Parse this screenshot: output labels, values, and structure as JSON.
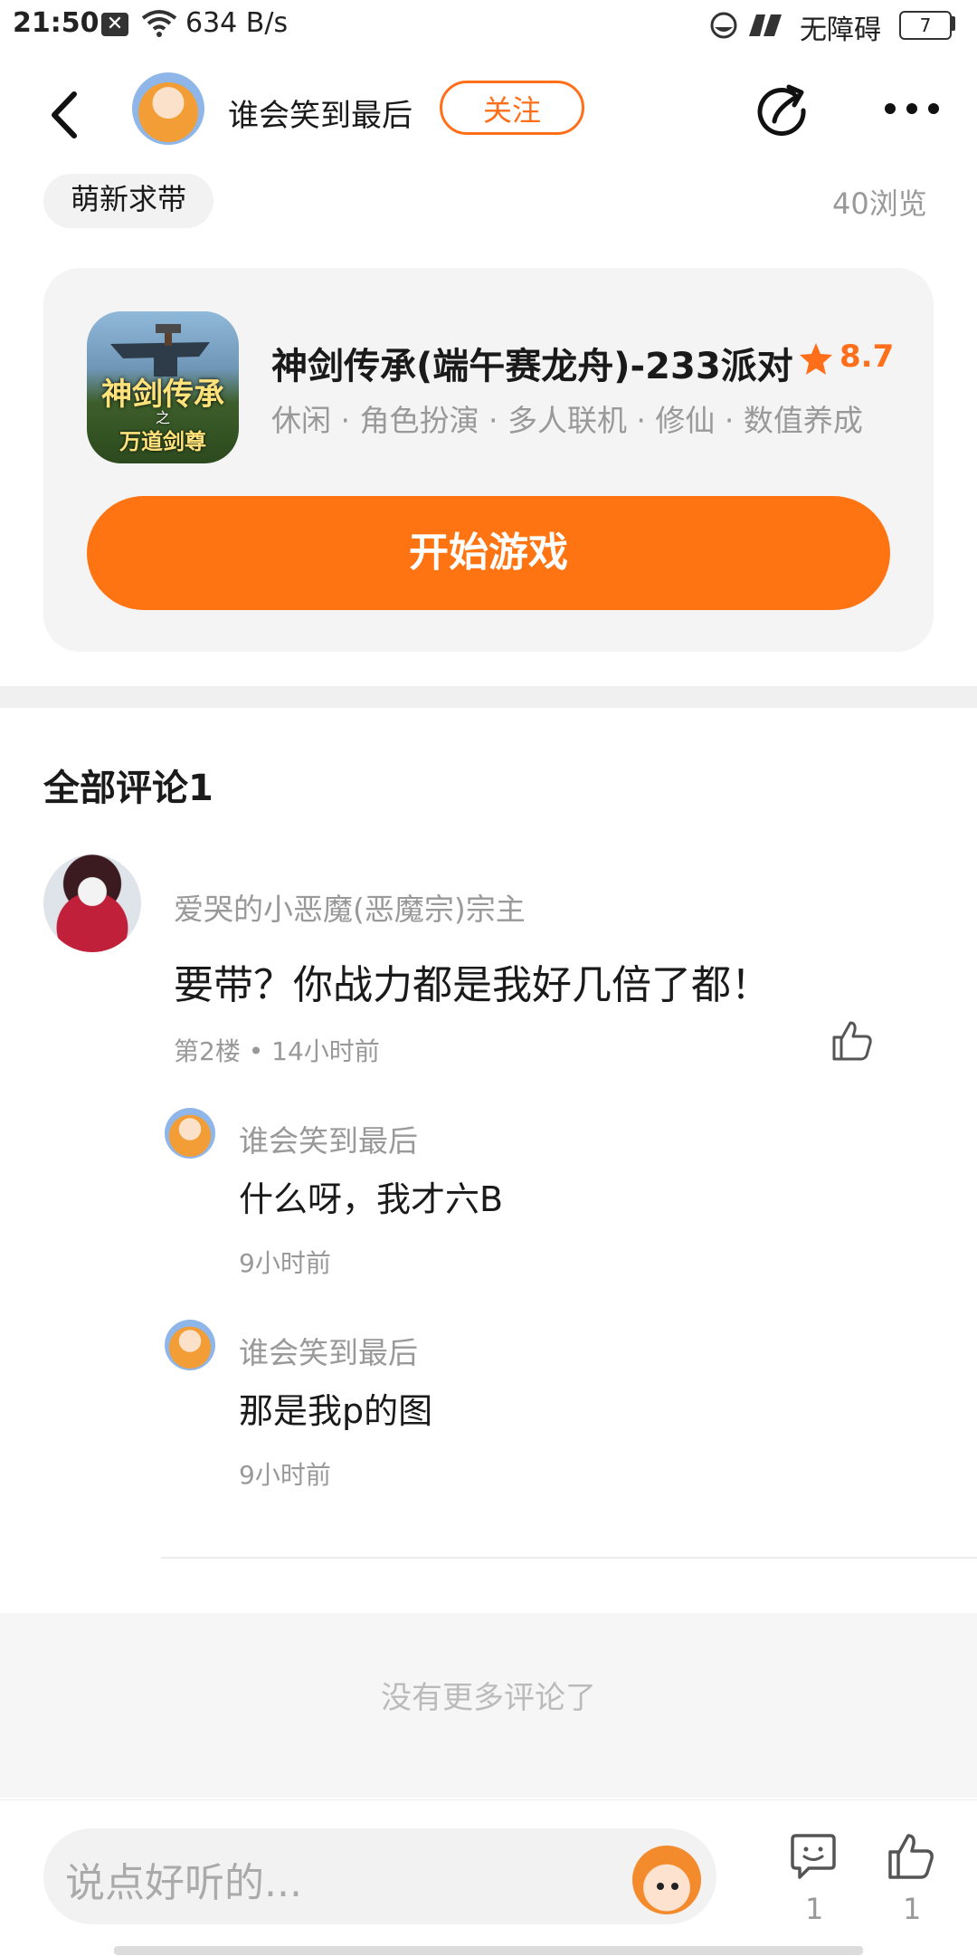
{
  "status_bar": {
    "time": "21:50",
    "network_speed": "634 B/s",
    "accessibility": "无障碍",
    "battery": "7"
  },
  "header": {
    "username": "谁会笑到最后",
    "follow_label": "关注"
  },
  "post": {
    "tag": "萌新求带",
    "views": "40浏览"
  },
  "game_card": {
    "title": "神剑传承(端午赛龙舟)-233派对",
    "rating": "8.7",
    "tags": "休闲 · 角色扮演 · 多人联机 · 修仙 · 数值养成",
    "start_label": "开始游戏",
    "icon_text": "神剑传承",
    "icon_sub": "之",
    "icon_sub2": "万道剑尊"
  },
  "comments": {
    "title": "全部评论1",
    "items": [
      {
        "name": "爱哭的小恶魔(恶魔宗)宗主",
        "text": "要带？你战力都是我好几倍了都！",
        "meta": "第2楼 • 14小时前",
        "replies": [
          {
            "name": "谁会笑到最后",
            "text": "什么呀，我才六B",
            "time": "9小时前"
          },
          {
            "name": "谁会笑到最后",
            "text": "那是我p的图",
            "time": "9小时前"
          }
        ]
      }
    ],
    "no_more": "没有更多评论了"
  },
  "bottom_bar": {
    "placeholder": "说点好听的...",
    "comment_count": "1",
    "like_count": "1"
  },
  "colors": {
    "accent": "#ff7412",
    "muted_text": "#999999"
  }
}
